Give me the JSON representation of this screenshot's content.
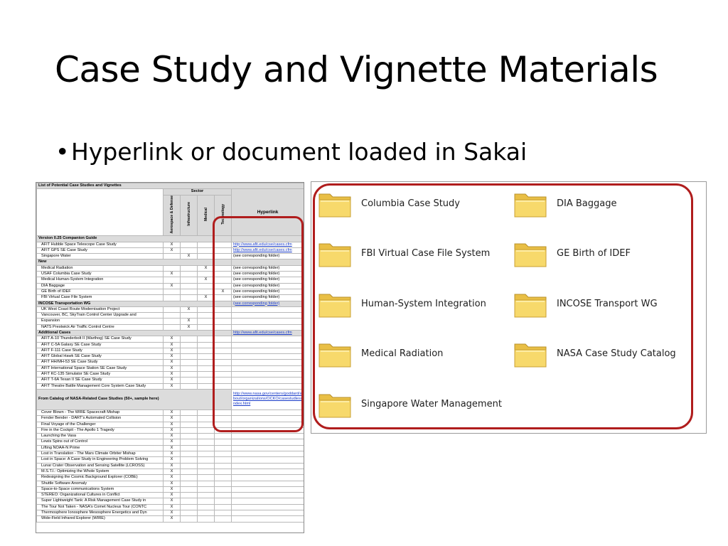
{
  "slide": {
    "title": "Case Study and Vignette Materials",
    "bullet": "Hyperlink  or document loaded in Sakai"
  },
  "sheet": {
    "title": "List of Potential Case Studies and Vignettes",
    "sector_header": "Sector",
    "columns": [
      "Aerospace & Defense",
      "Infrastructure",
      "Medical",
      "Technology"
    ],
    "hyperlink_header": "Hyperlink",
    "rows": [
      {
        "type": "section",
        "label": "Version 0.25 Companion Guide",
        "a": "",
        "i": "",
        "m": "",
        "t": "",
        "link": ""
      },
      {
        "type": "row",
        "label": "AFIT Hubble Space Telescope Case Study",
        "a": "X",
        "i": "",
        "m": "",
        "t": "",
        "link": "http://www.afit.edu/cse/cases.cfm"
      },
      {
        "type": "row",
        "label": "AFIT GPS SE Case Study",
        "a": "X",
        "i": "",
        "m": "",
        "t": "",
        "link": "http://www.afit.edu/cse/cases.cfm"
      },
      {
        "type": "row",
        "label": "Singapore Water",
        "a": "",
        "i": "X",
        "m": "",
        "t": "",
        "link": "(see corresponding folder)"
      },
      {
        "type": "section",
        "label": "New",
        "a": "",
        "i": "",
        "m": "",
        "t": "",
        "link": ""
      },
      {
        "type": "row",
        "label": "Medical Radiation",
        "a": "",
        "i": "",
        "m": "X",
        "t": "",
        "link": "(see corresponding folder)"
      },
      {
        "type": "row",
        "label": "USAF Columbia Case Study",
        "a": "X",
        "i": "",
        "m": "",
        "t": "",
        "link": "(see corresponding folder)"
      },
      {
        "type": "row",
        "label": "Medical Human-System Integration",
        "a": "",
        "i": "",
        "m": "X",
        "t": "",
        "link": "(see corresponding folder)"
      },
      {
        "type": "row",
        "label": "DIA Baggage",
        "a": "X",
        "i": "",
        "m": "",
        "t": "",
        "link": "(see corresponding folder)"
      },
      {
        "type": "row",
        "label": "GE Birth of IDEF",
        "a": "",
        "i": "",
        "m": "",
        "t": "X",
        "link": "(see corresponding folder)"
      },
      {
        "type": "row",
        "label": "FBI Virtual Case File System",
        "a": "",
        "i": "",
        "m": "X",
        "t": "",
        "link": "(see corresponding folder)"
      },
      {
        "type": "section",
        "label": "INCOSE Transportation WG",
        "a": "",
        "i": "",
        "m": "",
        "t": "",
        "link": "(see corresponding folder)"
      },
      {
        "type": "row",
        "label": "UK West Coast Route Modernisation Project",
        "a": "",
        "i": "X",
        "m": "",
        "t": "",
        "link": ""
      },
      {
        "type": "row",
        "label": "Vancouver, BC, SkyTrain Control Center Upgrade and",
        "a": "",
        "i": "",
        "m": "",
        "t": "",
        "link": ""
      },
      {
        "type": "row",
        "label": "Expansion",
        "a": "",
        "i": "X",
        "m": "",
        "t": "",
        "link": ""
      },
      {
        "type": "row",
        "label": "NATS Prestwick Air Traffic Control Centre",
        "a": "",
        "i": "X",
        "m": "",
        "t": "",
        "link": ""
      },
      {
        "type": "section",
        "label": "Additional Cases",
        "a": "",
        "i": "",
        "m": "",
        "t": "",
        "link": "http://www.afit.edu/cse/cases.cfm"
      },
      {
        "type": "row",
        "label": "AFIT A-10 Thunderbolt II (Warthog) SE Case Study",
        "a": "X",
        "i": "",
        "m": "",
        "t": "",
        "link": ""
      },
      {
        "type": "row",
        "label": "AFIT C-5A Galaxy SE Case Study",
        "a": "X",
        "i": "",
        "m": "",
        "t": "",
        "link": ""
      },
      {
        "type": "row",
        "label": "AFIT F-111 Case Study",
        "a": "X",
        "i": "",
        "m": "",
        "t": "",
        "link": ""
      },
      {
        "type": "row",
        "label": "AFIT Global Hawk SE Case Study",
        "a": "X",
        "i": "",
        "m": "",
        "t": "",
        "link": ""
      },
      {
        "type": "row",
        "label": "AFIT HH/MH-53 SE Case Study",
        "a": "X",
        "i": "",
        "m": "",
        "t": "",
        "link": ""
      },
      {
        "type": "row",
        "label": "AFIT International Space Station SE Case Study",
        "a": "X",
        "i": "",
        "m": "",
        "t": "",
        "link": ""
      },
      {
        "type": "row",
        "label": "AFIT KC-135 Simulator SE Case Study",
        "a": "X",
        "i": "",
        "m": "",
        "t": "",
        "link": ""
      },
      {
        "type": "row",
        "label": "AFIT T-6A Texan II SE Case Study",
        "a": "X",
        "i": "",
        "m": "",
        "t": "",
        "link": ""
      },
      {
        "type": "row",
        "label": "AFIT Theatre Battle Management Core System Case Study",
        "a": "X",
        "i": "",
        "m": "",
        "t": "",
        "link": ""
      }
    ],
    "nasa_section": {
      "label": "From Catalog of NASA-Related Case Studies (50+, sample here)",
      "link": "http://www.nasa.gov/centers/goddard/about/organizations/OCKO/casestudies/index.html"
    },
    "nasa_rows": [
      "Cover Blown - The WIRE Spacecraft Mishap",
      "Fender Bender - DART's Automated Collision",
      "Final Voyage of the Challenger",
      "Fire in the Cockpit - The Apollo 1 Tragedy",
      "Launching the Vasa",
      "Lewis Spins out of Control",
      "Lifting NOAA-N Prime",
      "Lost in Translation - The Mars Climate Orbiter Mishap",
      "Lost in Space: A Case Study in Engineering Problem Solving",
      "Lunar Crater Observation and Sensing Satellite (LCROSS)",
      "M.S.T.I.: Optimizing the Whole System",
      "Redesigning the Cosmic Background Explorer (COBE)",
      "Shuttle Software Anomaly",
      "Space-to-Space communications System",
      "STEREO: Organizational Cultures in Conflict",
      "Super Lightweight Tank: A Risk Management Case Study in",
      "The Tour Not Taken - NASA's Comet Nucleus Tour (CONTC",
      "Thermosphere Ionosphere Mesosphere Energetics and Dyn",
      "Wide-Field Infrared Explorer (WIRE)"
    ],
    "nasa_mark": "X"
  },
  "folders": [
    {
      "name": "Columbia Case Study"
    },
    {
      "name": "DIA Baggage"
    },
    {
      "name": "FBI Virtual Case File System"
    },
    {
      "name": "GE Birth of IDEF"
    },
    {
      "name": "Human-System Integration"
    },
    {
      "name": "INCOSE Transport WG"
    },
    {
      "name": "Medical Radiation"
    },
    {
      "name": "NASA Case Study Catalog"
    },
    {
      "name": "Singapore Water Management"
    }
  ],
  "colors": {
    "highlight": "#b01d1d",
    "folder_fill": "#f7d96b",
    "link": "#1a3cc8"
  }
}
